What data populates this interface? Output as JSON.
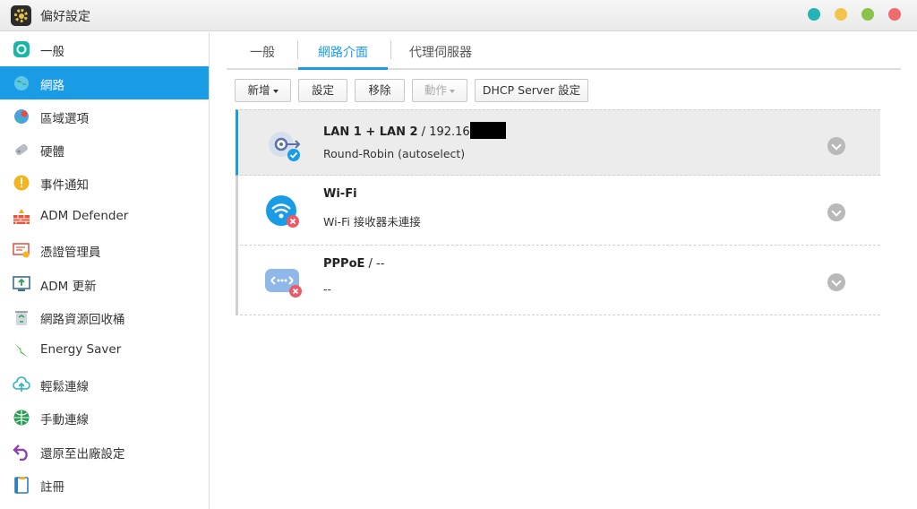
{
  "window": {
    "title": "偏好設定"
  },
  "window_dots": [
    {
      "name": "teal",
      "color": "#26b3b3"
    },
    {
      "name": "yellow",
      "color": "#f3c44a"
    },
    {
      "name": "green",
      "color": "#8bc34a"
    },
    {
      "name": "red",
      "color": "#f06b6b"
    }
  ],
  "sidebar": {
    "active_index": 1,
    "items": [
      {
        "label": "一般",
        "icon": "general-icon"
      },
      {
        "label": "網路",
        "icon": "network-globe-icon"
      },
      {
        "label": "區域選項",
        "icon": "region-icon"
      },
      {
        "label": "硬體",
        "icon": "hardware-icon"
      },
      {
        "label": "事件通知",
        "icon": "notification-icon"
      },
      {
        "label": "ADM Defender",
        "icon": "firewall-icon"
      },
      {
        "label": "憑證管理員",
        "icon": "certificate-icon"
      },
      {
        "label": "ADM 更新",
        "icon": "update-icon"
      },
      {
        "label": "網路資源回收桶",
        "icon": "recycle-bin-icon"
      },
      {
        "label": "Energy Saver",
        "icon": "energy-icon"
      },
      {
        "label": "輕鬆連線",
        "icon": "cloud-connect-icon"
      },
      {
        "label": "手動連線",
        "icon": "manual-connect-icon"
      },
      {
        "label": "還原至出廠設定",
        "icon": "restore-icon"
      },
      {
        "label": "註冊",
        "icon": "register-icon"
      }
    ]
  },
  "tabs": [
    {
      "label": "一般"
    },
    {
      "label": "網路介面"
    },
    {
      "label": "代理伺服器"
    }
  ],
  "toolbar": {
    "add_label": "新增",
    "settings_label": "設定",
    "remove_label": "移除",
    "action_label": "動作",
    "dhcp_label": "DHCP Server 設定"
  },
  "interfaces": [
    {
      "name": "LAN 1 + LAN 2",
      "suffix": " / 192.16",
      "detail": "Round-Robin (autoselect)",
      "status": "connected"
    },
    {
      "name": "Wi-Fi",
      "suffix": "",
      "detail": "Wi-Fi 接收器未連接",
      "status": "disconnected"
    },
    {
      "name": "PPPoE",
      "suffix": " / --",
      "detail": "--",
      "status": "disconnected"
    }
  ]
}
